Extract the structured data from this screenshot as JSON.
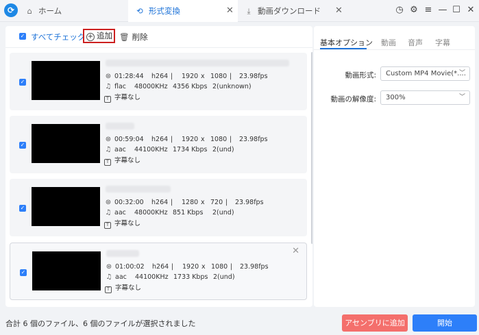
{
  "tabs": {
    "home": {
      "label": "ホーム",
      "icon": "home-icon"
    },
    "convert": {
      "label": "形式変換",
      "icon": "convert-icon"
    },
    "download": {
      "label": "動画ダウンロード",
      "icon": "download-icon"
    }
  },
  "toolbar": {
    "check_all_label": "すべてチェック",
    "add_label": "追加",
    "delete_label": "削除"
  },
  "files": [
    {
      "checked": true,
      "duration": "01:28:44",
      "vcodec": "h264",
      "width": "1920",
      "x": "x",
      "height": "1080",
      "fps": "23.98fps",
      "acodec": "flac",
      "samplerate": "48000KHz",
      "bitrate": "4356 Kbps",
      "channels": "2(unknown)",
      "subtitle": "字幕なし"
    },
    {
      "checked": true,
      "duration": "00:59:04",
      "vcodec": "h264",
      "width": "1920",
      "x": "x",
      "height": "1080",
      "fps": "23.98fps",
      "acodec": "aac",
      "samplerate": "44100KHz",
      "bitrate": "1734 Kbps",
      "channels": "2(und)",
      "subtitle": "字幕なし"
    },
    {
      "checked": true,
      "duration": "00:32:00",
      "vcodec": "h264",
      "width": "1280",
      "x": "x",
      "height": "720",
      "fps": "23.98fps",
      "acodec": "aac",
      "samplerate": "48000KHz",
      "bitrate": "851 Kbps",
      "channels": "2(und)",
      "subtitle": "字幕なし"
    },
    {
      "checked": true,
      "duration": "01:00:02",
      "vcodec": "h264",
      "width": "1920",
      "x": "x",
      "height": "1080",
      "fps": "23.98fps",
      "acodec": "aac",
      "samplerate": "44100KHz",
      "bitrate": "1733 Kbps",
      "channels": "2(und)",
      "subtitle": "字幕なし"
    }
  ],
  "right_tabs": [
    "基本オプション",
    "動画",
    "音声",
    "字幕"
  ],
  "options": {
    "format_label": "動画形式:",
    "format_value": "Custom MP4 Movie(*....",
    "resolution_label": "動画の解像度:",
    "resolution_value": "300%"
  },
  "status_text": "合計 6 個のファイル、6 個のファイルが選択されました",
  "buttons": {
    "merge": "アセンブリに追加",
    "start": "開始"
  },
  "colors": {
    "accent": "#2d7ff9",
    "merge": "#f46f6c",
    "highlight_border": "#cc1f1f"
  }
}
